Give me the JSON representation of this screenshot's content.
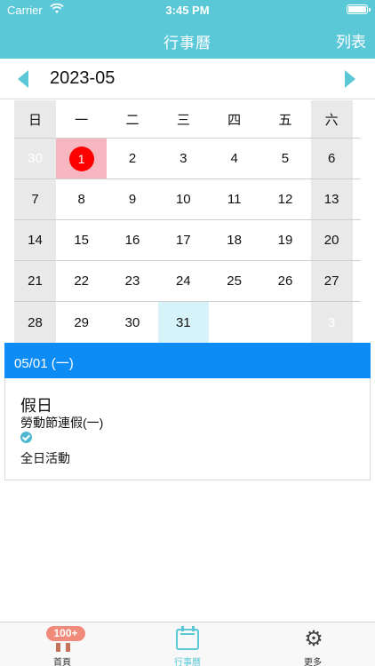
{
  "status": {
    "carrier": "Carrier",
    "time": "3:45 PM"
  },
  "nav": {
    "title": "行事曆",
    "right_button": "列表"
  },
  "month": {
    "label": "2023-05"
  },
  "calendar": {
    "weekdays": [
      "日",
      "一",
      "二",
      "三",
      "四",
      "五",
      "六"
    ],
    "weeks": [
      [
        "30",
        "1",
        "2",
        "3",
        "4",
        "5",
        "6"
      ],
      [
        "7",
        "8",
        "9",
        "10",
        "11",
        "12",
        "13"
      ],
      [
        "14",
        "15",
        "16",
        "17",
        "18",
        "19",
        "20"
      ],
      [
        "21",
        "22",
        "23",
        "24",
        "25",
        "26",
        "27"
      ],
      [
        "28",
        "29",
        "30",
        "31",
        "",
        "",
        "3"
      ]
    ]
  },
  "selected": {
    "date_label": "05/01 (一)"
  },
  "event": {
    "title": "假日",
    "description": "勞動節連假(一)",
    "all_day": "全日活動"
  },
  "tabs": [
    {
      "label": "首頁",
      "badge": "100+",
      "icon": "home-icon"
    },
    {
      "label": "行事曆",
      "icon": "calendar-icon"
    },
    {
      "label": "更多",
      "icon": "gear-icon"
    }
  ],
  "colors": {
    "header": "#5bc8d8",
    "date_bar": "#0d8cf5",
    "today_dot": "#ff0000",
    "holiday": "#f7b7c0",
    "today_cell": "#d7f3fa"
  }
}
